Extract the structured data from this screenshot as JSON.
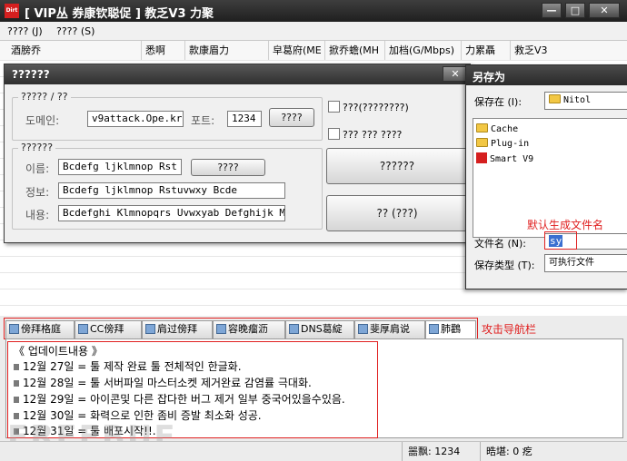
{
  "titlebar": {
    "app_icon_text": "Dirt",
    "title": "[ VIP丛 券康钦聪促 ] 教乏V3 力聚",
    "minimize": "—",
    "maximize": "□",
    "close": "✕"
  },
  "menubar": {
    "items": [
      "???? (J)",
      "???? (S)"
    ]
  },
  "columns": [
    "酒膀乔",
    "悉啊",
    "款康眉力",
    "皁葛府(ME",
    "掀乔蟾(MH",
    "加档(G/Mbps)",
    "力累聶",
    "救乏V3"
  ],
  "dialog": {
    "title": "??????",
    "close": "✕",
    "group1_label": "????? / ??",
    "domain_label": "도메인:",
    "domain_value": "v9attack.Ope.kr",
    "port_label": "포트:",
    "port_value": "1234",
    "group1_button": "????",
    "check1_label": "???(????????)",
    "check2_label": "??? ??? ????",
    "group2_label": "??????",
    "name_label": "이름:",
    "name_value": "Bcdefg ljklmnop Rst",
    "name_button": "????",
    "info_label": "정보:",
    "info_value": "Bcdefg ljklmnop Rstuvwxy Bcde",
    "content_label": "내용:",
    "content_value": "Bcdefghi Klmnopqrs Uvwxyab Defghijk Mno",
    "big_button1": "??????",
    "big_button2": "?? (???)"
  },
  "saveas": {
    "title": "另存为",
    "save_in_label": "保存在 (I):",
    "save_in_value": "Nitol",
    "files": [
      {
        "name": "Cache",
        "icon": "folder-icon"
      },
      {
        "name": "Plug-in",
        "icon": "folder-icon"
      },
      {
        "name": "Smart V9",
        "icon": "app-file-icon"
      }
    ],
    "filename_label": "文件名 (N):",
    "filename_value": "sy",
    "filetype_label": "保存类型 (T):",
    "filetype_value": "可执行文件"
  },
  "annotations": {
    "default_filename": "默认生成文件名",
    "attack_nav": "攻击导航栏"
  },
  "tabs": [
    "傍拜格庭",
    "CC傍拜",
    "肩过傍拜",
    "容晚瘤沥",
    "DNS葛綻",
    "斐厚肩说",
    "肺鸛"
  ],
  "log": {
    "header": "《 업데이트내용 》",
    "lines": [
      "12월 27일 = 툴 제작 완료 툴 전체적인 한글화.",
      "12월 28일 = 툴 서버파일 마스터소켓 제거완료 감염률 극대화.",
      "12월 29일 = 아이콘및 다른 잡다한 버그 제거 일부 중국어있을수있음.",
      "12월 30일 = 화력으로 인한 좀비 증발 최소화 성공.",
      "12월 31일 = 툴 배포시작!!."
    ]
  },
  "statusbar": {
    "seg1_label": "噐飘:",
    "seg1_value": "1234",
    "seg2_label": "晧堪:",
    "seg2_value": "0 疙"
  },
  "watermark": "FREEBUF",
  "colors": {
    "titlebar": "#2f2f2f",
    "annotation": "#e02020",
    "app_icon": "#d51f1f"
  }
}
